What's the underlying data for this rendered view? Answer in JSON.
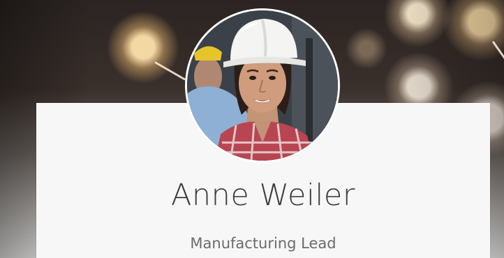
{
  "profile": {
    "name": "Anne Weiler",
    "title": "Manufacturing Lead"
  },
  "colors": {
    "card_background": "#f7f7f7",
    "name_text": "#3c3c3c",
    "title_text": "#6b6b6b",
    "avatar_border": "#ffffff"
  },
  "icons": {
    "avatar": "profile-photo"
  }
}
